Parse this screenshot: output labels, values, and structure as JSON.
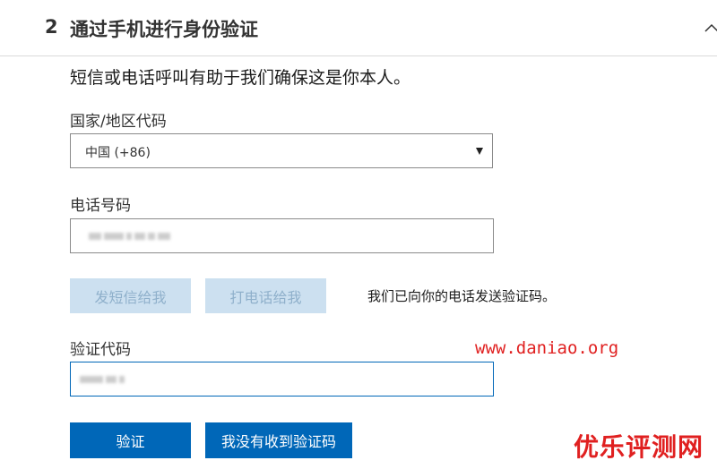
{
  "header": {
    "step_number": "2",
    "title": "通过手机进行身份验证"
  },
  "intro_text": "短信或电话呼叫有助于我们确保这是你本人。",
  "country": {
    "label": "国家/地区代码",
    "selected": "中国 (+86)"
  },
  "phone": {
    "label": "电话号码"
  },
  "buttons": {
    "send_sms": "发短信给我",
    "call_me": "打电话给我",
    "verify": "验证",
    "no_code": "我没有收到验证码"
  },
  "status_text": "我们已向你的电话发送验证码。",
  "code": {
    "label": "验证代码"
  },
  "watermarks": {
    "url": "www.daniao.org",
    "brand": "优乐评测网"
  },
  "colors": {
    "primary": "#0067b8",
    "disabled_bg": "#cce0f0",
    "watermark": "#e02020"
  },
  "icons": {
    "collapse": "chevron-up-icon",
    "dropdown": "caret-down-icon"
  }
}
